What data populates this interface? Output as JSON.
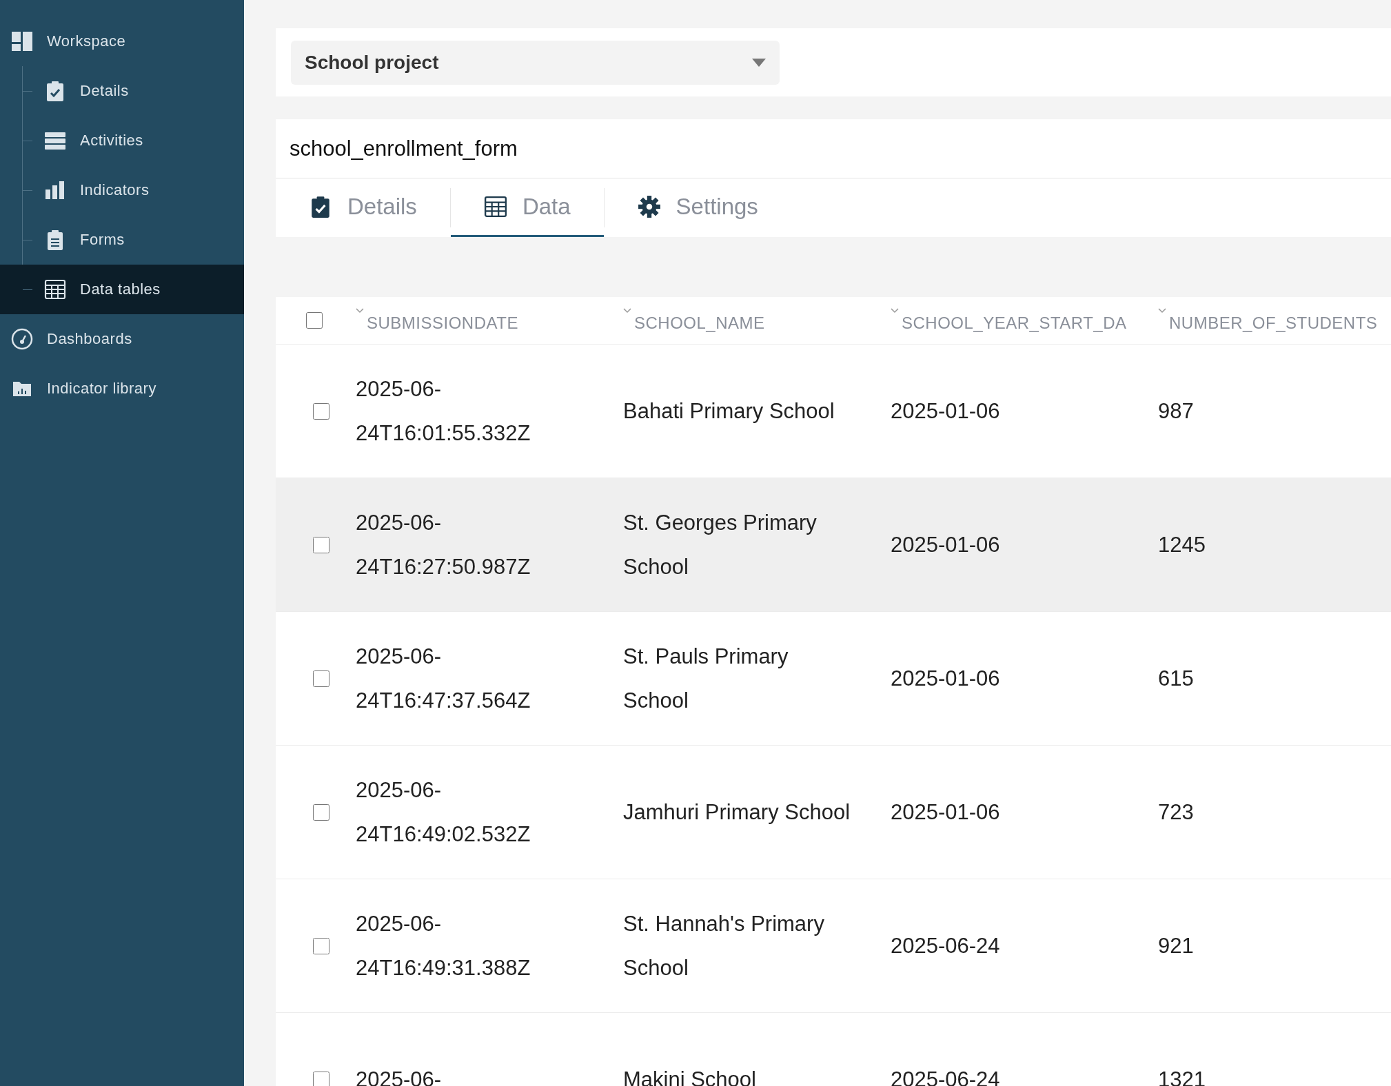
{
  "sidebar": {
    "items": [
      {
        "kind": "parent",
        "label": "Workspace",
        "selected": false,
        "children": [
          {
            "label": "Details",
            "selected": false
          },
          {
            "label": "Activities",
            "selected": false
          },
          {
            "label": "Indicators",
            "selected": false
          },
          {
            "label": "Forms",
            "selected": false
          },
          {
            "label": "Data tables",
            "selected": true
          }
        ]
      },
      {
        "kind": "leaf",
        "label": "Dashboards",
        "selected": false
      },
      {
        "kind": "leaf",
        "label": "Indicator library",
        "selected": false
      }
    ]
  },
  "project_select": {
    "value": "School project"
  },
  "form": {
    "title": "school_enrollment_form",
    "tabs": [
      {
        "label": "Details",
        "selected": false
      },
      {
        "label": "Data",
        "selected": true
      },
      {
        "label": "Settings",
        "selected": false
      }
    ]
  },
  "table": {
    "select_all_checked": false,
    "columns": [
      "SUBMISSIONDATE",
      "SCHOOL_NAME",
      "SCHOOL_YEAR_START_DA",
      "NUMBER_OF_STUDENTS"
    ],
    "rows": [
      {
        "checked": false,
        "highlighted": false,
        "cells": [
          [
            "2025-06-",
            "24T16:01:55.332Z"
          ],
          [
            "Bahati Primary School"
          ],
          [
            "2025-01-06"
          ],
          [
            "987"
          ]
        ]
      },
      {
        "checked": false,
        "highlighted": true,
        "cells": [
          [
            "2025-06-",
            "24T16:27:50.987Z"
          ],
          [
            "St. Georges Primary",
            "School"
          ],
          [
            "2025-01-06"
          ],
          [
            "1245"
          ]
        ]
      },
      {
        "checked": false,
        "highlighted": false,
        "cells": [
          [
            "2025-06-",
            "24T16:47:37.564Z"
          ],
          [
            "St. Pauls Primary",
            "School"
          ],
          [
            "2025-01-06"
          ],
          [
            "615"
          ]
        ]
      },
      {
        "checked": false,
        "highlighted": false,
        "cells": [
          [
            "2025-06-",
            "24T16:49:02.532Z"
          ],
          [
            "Jamhuri Primary School"
          ],
          [
            "2025-01-06"
          ],
          [
            "723"
          ]
        ]
      },
      {
        "checked": false,
        "highlighted": false,
        "cells": [
          [
            "2025-06-",
            "24T16:49:31.388Z"
          ],
          [
            "St. Hannah's Primary",
            "School"
          ],
          [
            "2025-06-24"
          ],
          [
            "921"
          ]
        ]
      },
      {
        "checked": false,
        "highlighted": false,
        "cells": [
          [
            "2025-06-"
          ],
          [
            "Makini School"
          ],
          [
            "2025-06-24"
          ],
          [
            "1321"
          ]
        ]
      }
    ]
  }
}
